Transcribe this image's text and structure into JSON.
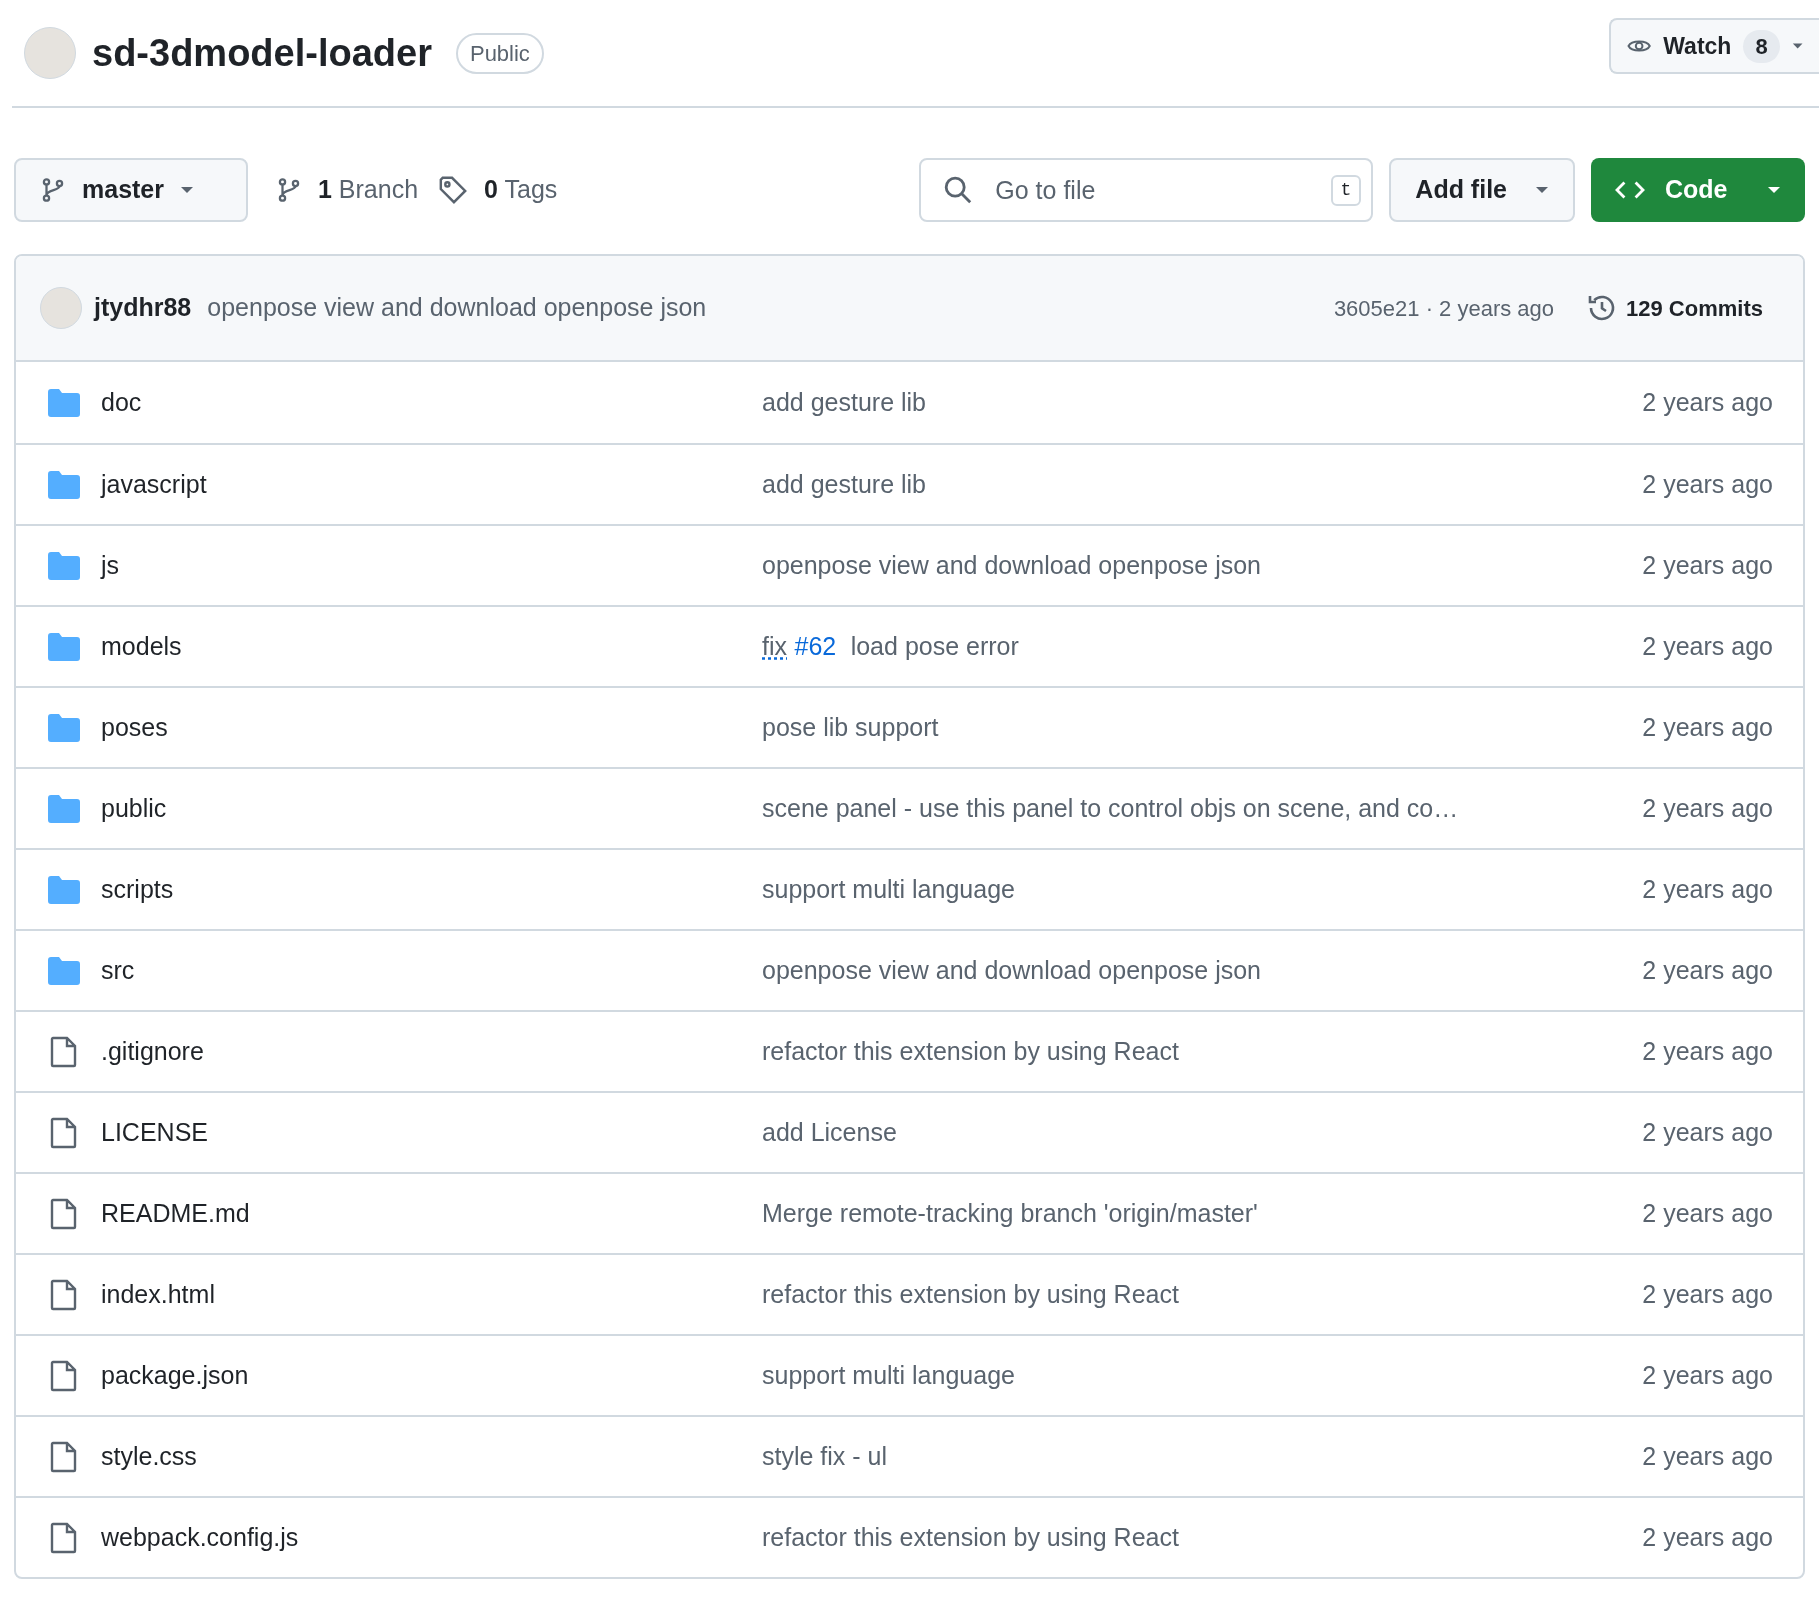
{
  "repo": {
    "name": "sd-3dmodel-loader",
    "visibility": "Public"
  },
  "watch": {
    "label": "Watch",
    "count": "8"
  },
  "toolbar": {
    "branch": "master",
    "branches": {
      "count": "1",
      "label": "Branch"
    },
    "tags": {
      "count": "0",
      "label": "Tags"
    },
    "search": {
      "placeholder": "Go to file",
      "shortcut": "t"
    },
    "add_file": "Add file",
    "code": "Code"
  },
  "latest_commit": {
    "author": "jtydhr88",
    "message": "openpose view and download openpose json",
    "hash_time": "3605e21 · 2 years ago",
    "commits": "129 Commits"
  },
  "files": [
    {
      "kind": "folder",
      "name": "doc",
      "message": [
        {
          "kind": "text",
          "text": "add gesture lib"
        }
      ],
      "time": "2 years ago"
    },
    {
      "kind": "folder",
      "name": "javascript",
      "message": [
        {
          "kind": "text",
          "text": "add gesture lib"
        }
      ],
      "time": "2 years ago"
    },
    {
      "kind": "folder",
      "name": "js",
      "message": [
        {
          "kind": "text",
          "text": "openpose view and download openpose json"
        }
      ],
      "time": "2 years ago"
    },
    {
      "kind": "folder",
      "name": "models",
      "message": [
        {
          "kind": "dotted",
          "text": "fix"
        },
        {
          "kind": "link",
          "text": "#62"
        },
        {
          "kind": "text",
          "text": " load pose error"
        }
      ],
      "time": "2 years ago"
    },
    {
      "kind": "folder",
      "name": "poses",
      "message": [
        {
          "kind": "text",
          "text": "pose lib support"
        }
      ],
      "time": "2 years ago"
    },
    {
      "kind": "folder",
      "name": "public",
      "message": [
        {
          "kind": "text",
          "text": "scene panel - use this panel to control objs on scene, and co…"
        }
      ],
      "time": "2 years ago"
    },
    {
      "kind": "folder",
      "name": "scripts",
      "message": [
        {
          "kind": "text",
          "text": "support multi language"
        }
      ],
      "time": "2 years ago"
    },
    {
      "kind": "folder",
      "name": "src",
      "message": [
        {
          "kind": "text",
          "text": "openpose view and download openpose json"
        }
      ],
      "time": "2 years ago"
    },
    {
      "kind": "file",
      "name": ".gitignore",
      "message": [
        {
          "kind": "text",
          "text": "refactor this extension by using React"
        }
      ],
      "time": "2 years ago"
    },
    {
      "kind": "file",
      "name": "LICENSE",
      "message": [
        {
          "kind": "text",
          "text": "add License"
        }
      ],
      "time": "2 years ago"
    },
    {
      "kind": "file",
      "name": "README.md",
      "message": [
        {
          "kind": "text",
          "text": "Merge remote-tracking branch 'origin/master'"
        }
      ],
      "time": "2 years ago"
    },
    {
      "kind": "file",
      "name": "index.html",
      "message": [
        {
          "kind": "text",
          "text": "refactor this extension by using React"
        }
      ],
      "time": "2 years ago"
    },
    {
      "kind": "file",
      "name": "package.json",
      "message": [
        {
          "kind": "text",
          "text": "support multi language"
        }
      ],
      "time": "2 years ago"
    },
    {
      "kind": "file",
      "name": "style.css",
      "message": [
        {
          "kind": "text",
          "text": "style fix - ul"
        }
      ],
      "time": "2 years ago"
    },
    {
      "kind": "file",
      "name": "webpack.config.js",
      "message": [
        {
          "kind": "text",
          "text": "refactor this extension by using React"
        }
      ],
      "time": "2 years ago"
    }
  ]
}
